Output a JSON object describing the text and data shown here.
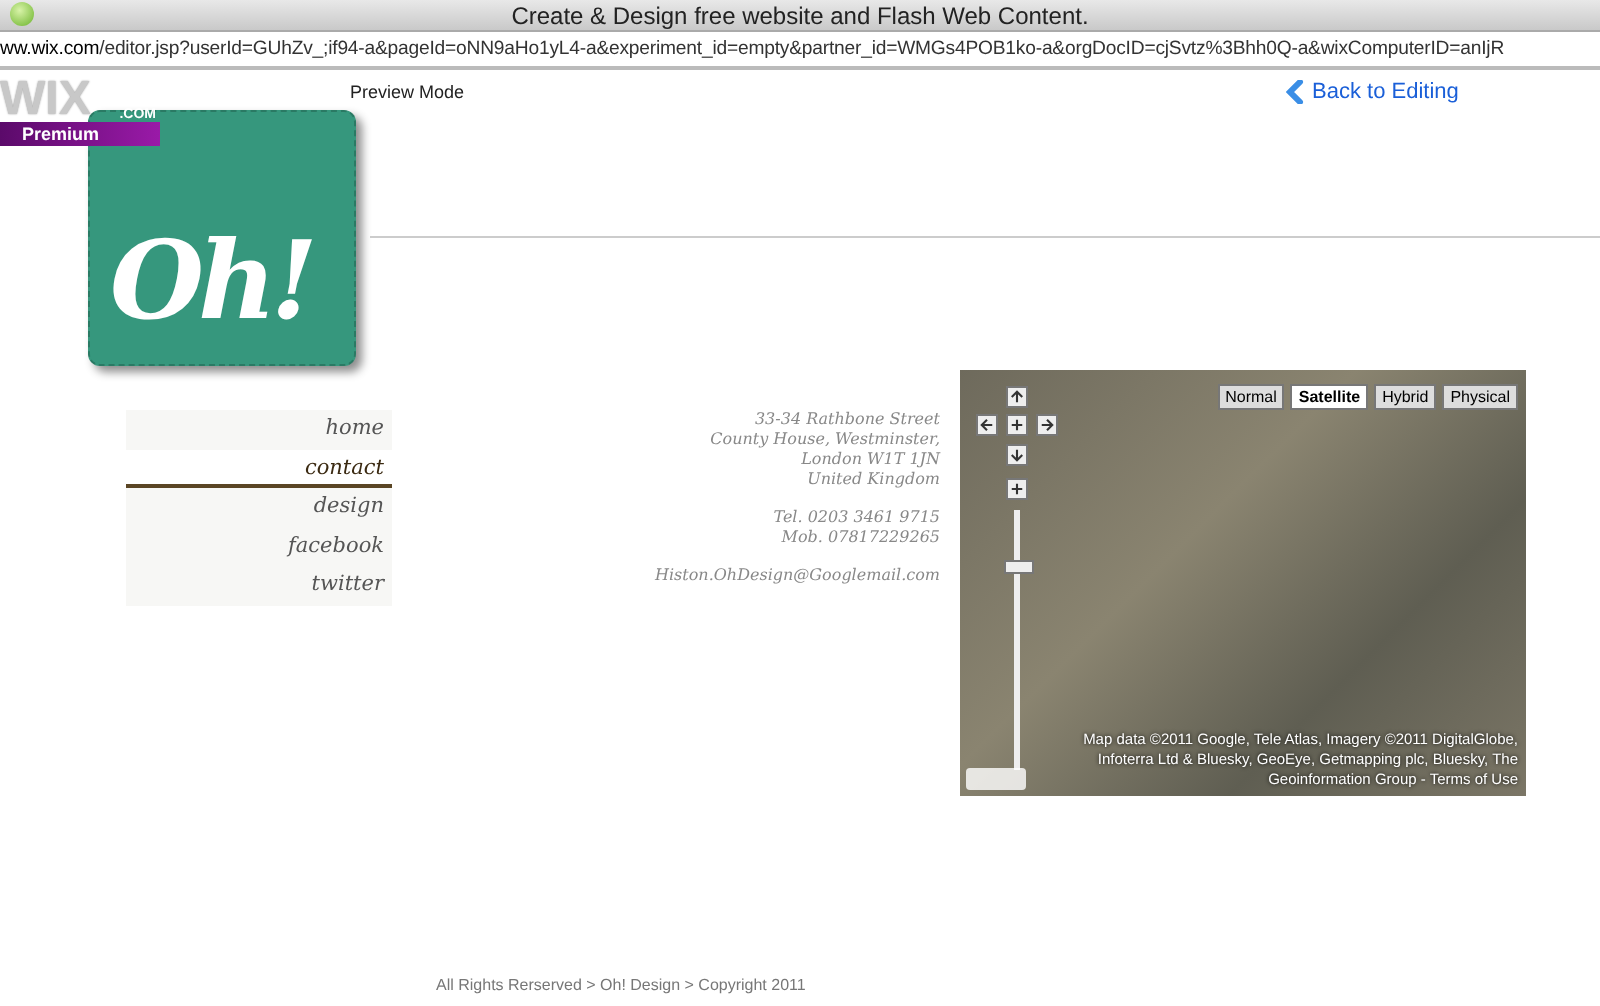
{
  "window": {
    "title": "Create & Design free website and Flash Web Content.",
    "url_domain": "ww.wix.com",
    "url_path": "/editor.jsp?userId=GUhZv_;if94-a&pageId=oNN9aHo1yL4-a&experiment_id=empty&partner_id=WMGs4POB1ko-a&orgDocID=cjSvtz%3Bhh0Q-a&wixComputerID=anIjR"
  },
  "editor_bar": {
    "mode": "Preview Mode",
    "back_link": "Back to Editing"
  },
  "badge": {
    "brand": "WIX",
    ".com": ".COM",
    "tier": "Premium"
  },
  "logo": {
    "text": "Oh!"
  },
  "nav": [
    {
      "label": "home",
      "selected": false
    },
    {
      "label": "contact",
      "selected": true
    },
    {
      "label": "design",
      "selected": false
    },
    {
      "label": "facebook",
      "selected": false
    },
    {
      "label": "twitter",
      "selected": false
    }
  ],
  "address": {
    "lines": [
      "33-34 Rathbone Street",
      "County House, Westminster,",
      "London W1T 1JN",
      "United Kingdom"
    ],
    "phones": [
      "Tel. 0203 3461 9715",
      "Mob. 07817229265"
    ],
    "email": "Histon.OhDesign@Googlemail.com"
  },
  "map": {
    "types": [
      {
        "label": "Normal",
        "selected": false
      },
      {
        "label": "Satellite",
        "selected": true
      },
      {
        "label": "Hybrid",
        "selected": false
      },
      {
        "label": "Physical",
        "selected": false
      }
    ],
    "attribution": "Map data ©2011 Google, Tele Atlas, Imagery ©2011 DigitalGlobe, Infoterra Ltd & Bluesky, GeoEye, Getmapping plc, Bluesky, The Geoinformation Group - Terms of Use"
  },
  "footer": "All Rights Rerserved > Oh! Design > Copyright 2011"
}
